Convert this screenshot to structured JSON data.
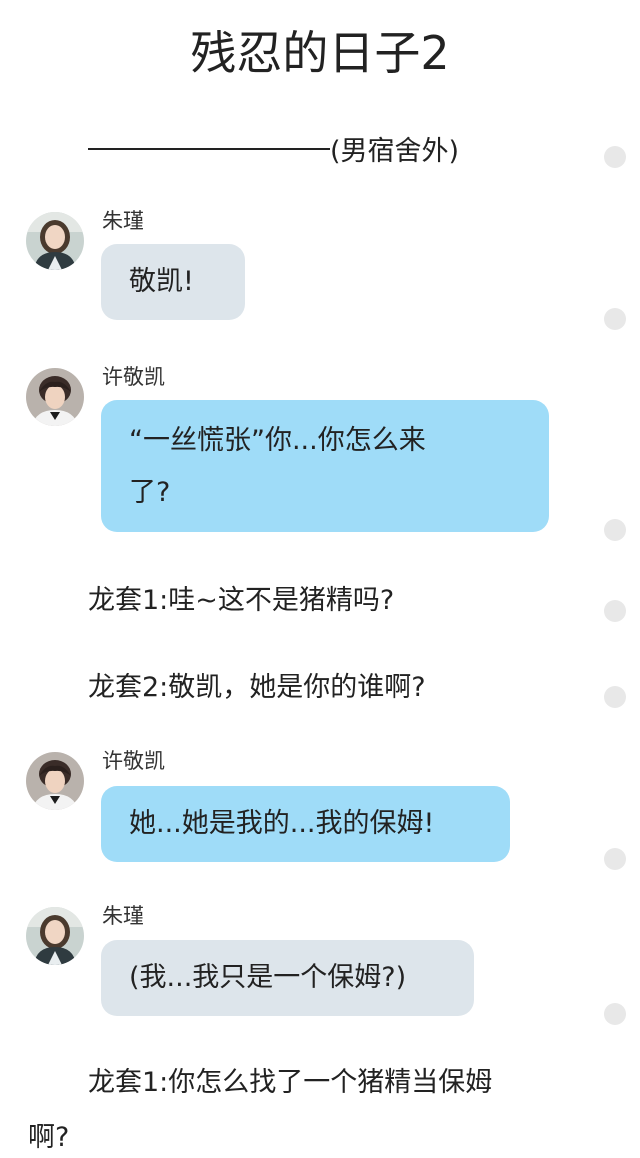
{
  "title": "残忍的日子2",
  "scene_label": "(男宿舍外)",
  "messages": [
    {
      "sender": "朱瑾",
      "text": "敬凯!"
    },
    {
      "sender": "许敬凯",
      "text_line1": "“一丝慌张”你...你怎么来",
      "text_line2": "了?"
    },
    {
      "sender": "许敬凯",
      "text": "她...她是我的...我的保姆!"
    },
    {
      "sender": "朱瑾",
      "text": "(我...我只是一个保姆?)"
    }
  ],
  "narrations": [
    "龙套1:哇~这不是猪精吗?",
    "龙套2:敬凯，她是你的谁啊?",
    "龙套1:你怎么找了一个猪精当保姆",
    "啊?"
  ],
  "colors": {
    "bubble_gray": "#dde5eb",
    "bubble_blue": "#9fdcf8",
    "scroll_dot": "#e8e8e8"
  },
  "icons": {
    "avatar_zhujin": "avatar-zhujin-icon",
    "avatar_xujingkai": "avatar-xujingkai-icon"
  }
}
